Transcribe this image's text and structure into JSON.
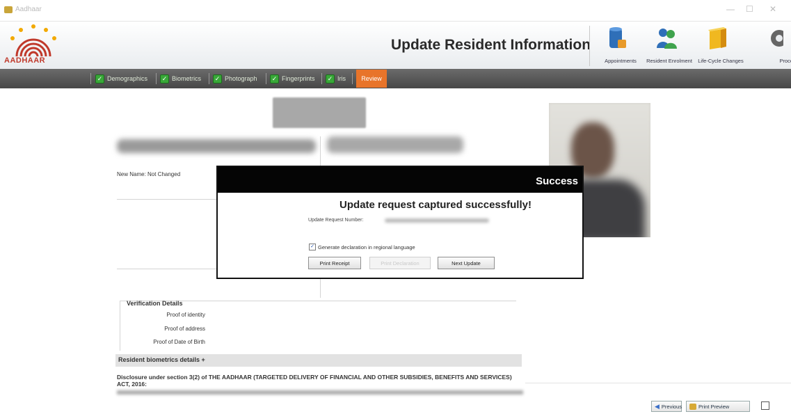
{
  "window": {
    "title": "Aadhaar"
  },
  "header": {
    "logo_text": "AADHAAR",
    "page_title": "Update Resident Information",
    "tools": [
      {
        "label": "Appointments",
        "icon": "database-icon"
      },
      {
        "label": "Resident Enrolment",
        "icon": "users-icon"
      },
      {
        "label": "Life-Cycle Changes",
        "icon": "box-icon"
      },
      {
        "label": "Process",
        "icon": "gear-icon"
      }
    ]
  },
  "nav": {
    "tabs": [
      {
        "label": "Demographics"
      },
      {
        "label": "Biometrics"
      },
      {
        "label": "Photograph"
      },
      {
        "label": "Fingerprints"
      },
      {
        "label": "Iris"
      }
    ],
    "active_tab": "Review"
  },
  "main": {
    "new_name_note": "New Name: Not Changed",
    "verification": {
      "title": "Verification Details",
      "labels": [
        "Proof of identity",
        "Proof of address",
        "Proof of Date of Birth"
      ]
    },
    "biometrics_header": "Resident biometrics details +",
    "disclosure": "Disclosure under section 3(2) of THE AADHAAR (TARGETED DELIVERY OF FINANCIAL AND OTHER SUBSIDIES, BENEFITS AND SERVICES) ACT, 2016:"
  },
  "footer": {
    "previous_label": "Previous",
    "print_preview_label": "Print Preview"
  },
  "modal": {
    "title": "Success",
    "message": "Update request captured successfully!",
    "urn_label": "Update Request Number:",
    "declaration_label": "Generate declaration in regional language",
    "print_receipt_label": "Print Receipt",
    "print_declaration_label": "Print Declaration",
    "next_update_label": "Next Update"
  },
  "colors": {
    "accent_orange": "#e8742a",
    "nav_dark": "#4d4d4d",
    "check_green": "#38a838"
  }
}
